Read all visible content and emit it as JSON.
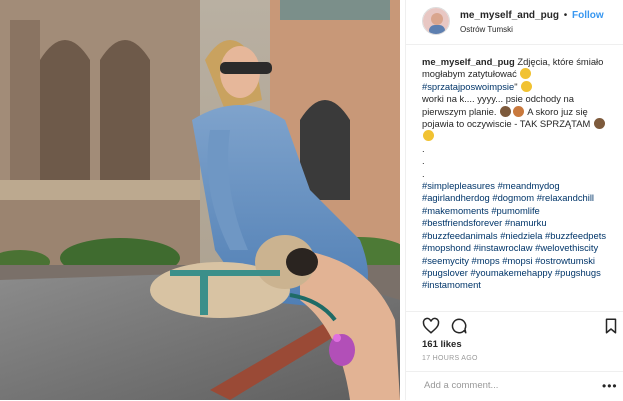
{
  "post": {
    "image_alt": "",
    "header": {
      "username": "me_myself_and_pug",
      "separator": "•",
      "follow_label": "Follow",
      "location": "Ostrów Tumski"
    },
    "caption": {
      "username": "me_myself_and_pug",
      "text_1": "Zdjęcia, które śmiało mogłabym zatytułować",
      "hashtag_1": "#sprzatajposwoimpsie",
      "text_2": "\"",
      "text_3": "worki na k.... yyyy... psie odchody na pierwszym planie.",
      "text_4": "A skoro juz się pojawia to oczywiscie - TAK SPRZĄTAM",
      "dots": [
        ".",
        ".",
        "."
      ],
      "hashtags": [
        "#simplepleasures",
        "#meandmydog",
        "#agirlandherdog",
        "#dogmom",
        "#relaxandchill",
        "#makemoments",
        "#pumomlife",
        "#bestfriendsforever",
        "#namurku",
        "#buzzfeedanimals",
        "#niedziela",
        "#buzzfeedpets",
        "#mopshond",
        "#instawroclaw",
        "#welovethiscity",
        "#seemycity",
        "#mops",
        "#mopsi",
        "#ostrowtumski",
        "#pugslover",
        "#youmakemehappy",
        "#pugshugs",
        "#instamoment"
      ]
    },
    "actions": {
      "like_icon": "heart-icon",
      "comment_icon": "comment-icon",
      "save_icon": "bookmark-icon"
    },
    "likes": "161 likes",
    "time_ago": "17 HOURS AGO",
    "comment": {
      "placeholder": "Add a comment...",
      "more_label": "•••"
    },
    "colors": {
      "link_blue": "#3897f0",
      "hashtag_blue": "#003569",
      "text": "#262626",
      "muted": "#999999",
      "border": "#efefef"
    }
  }
}
